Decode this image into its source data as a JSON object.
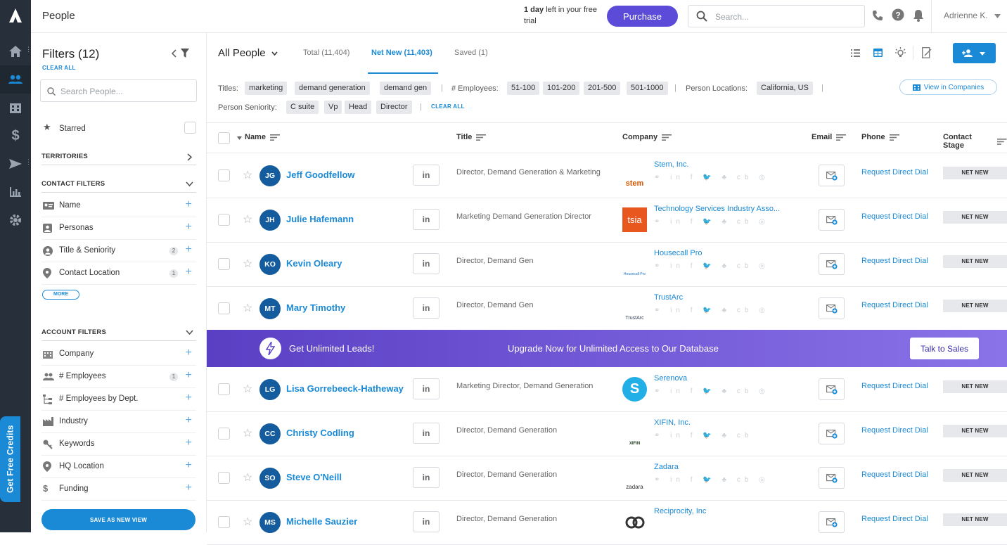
{
  "app": {
    "page_title": "People"
  },
  "topbar": {
    "trial_bold": "1 day",
    "trial_rest": " left in your free trial",
    "purchase_label": "Purchase",
    "search_placeholder": "Search...",
    "user_name": "Adrienne K."
  },
  "rail": {
    "get_free_credits": "Get Free Credits"
  },
  "sidebar": {
    "title": "Filters (12)",
    "clear_all": "CLEAR ALL",
    "search_placeholder": "Search People...",
    "starred": "Starred",
    "territories": "TERRITORIES",
    "contact_filters_header": "CONTACT FILTERS",
    "contact_filters": [
      {
        "label": "Name",
        "count": ""
      },
      {
        "label": "Personas",
        "count": ""
      },
      {
        "label": "Title & Seniority",
        "count": "2"
      },
      {
        "label": "Contact Location",
        "count": "1"
      }
    ],
    "more": "MORE",
    "account_filters_header": "ACCOUNT FILTERS",
    "account_filters": [
      {
        "label": "Company",
        "count": ""
      },
      {
        "label": "# Employees",
        "count": "1"
      },
      {
        "label": "# Employees by Dept.",
        "count": ""
      },
      {
        "label": "Industry",
        "count": ""
      },
      {
        "label": "Keywords",
        "count": ""
      },
      {
        "label": "HQ Location",
        "count": ""
      },
      {
        "label": "Funding",
        "count": ""
      }
    ],
    "save_view": "SAVE AS NEW VIEW"
  },
  "main": {
    "view_selector": "All People",
    "tabs": [
      {
        "label": "Total (11,404)"
      },
      {
        "label": "Net New (11,403)"
      },
      {
        "label": "Saved (1)"
      }
    ],
    "filters": {
      "titles_label": "Titles:",
      "titles": [
        "marketing",
        "demand generation",
        "demand gen"
      ],
      "employees_label": "# Employees:",
      "employees": [
        "51-100",
        "101-200",
        "201-500",
        "501-1000"
      ],
      "locations_label": "Person Locations:",
      "locations": [
        "California, US"
      ],
      "seniority_label": "Person Seniority:",
      "seniority": [
        "C suite",
        "Vp",
        "Head",
        "Director"
      ],
      "clear_all": "CLEAR ALL",
      "view_in_companies": "View in Companies"
    },
    "columns": {
      "name": "Name",
      "title": "Title",
      "company": "Company",
      "email": "Email",
      "phone": "Phone",
      "stage": "Contact Stage"
    },
    "rows": [
      {
        "initials": "JG",
        "name": "Jeff Goodfellow",
        "title": "Director, Demand Generation & Marketing",
        "company": "Stem, Inc.",
        "logo_text": "stem",
        "phone": "Request Direct Dial",
        "stage": "NET NEW",
        "socials": "⚭ in f 🐦 ♣ cb ◎"
      },
      {
        "initials": "JH",
        "name": "Julie Hafemann",
        "title": "Marketing Demand Generation Director",
        "company": "Technology Services Industry Asso...",
        "logo_text": "tsia",
        "phone": "Request Direct Dial",
        "stage": "NET NEW",
        "socials": "⚭ in f 🐦 ♣ cb ◎"
      },
      {
        "initials": "KO",
        "name": "Kevin Oleary",
        "title": "Director, Demand Gen",
        "company": "Housecall Pro",
        "logo_text": "Housecall Pro",
        "phone": "Request Direct Dial",
        "stage": "NET NEW",
        "socials": "⚭ in f 🐦 ♣ cb ◎"
      },
      {
        "initials": "MT",
        "name": "Mary Timothy",
        "title": "Director, Demand Gen",
        "company": "TrustArc",
        "logo_text": "TrustArc",
        "phone": "Request Direct Dial",
        "stage": "NET NEW",
        "socials": "⚭ in f 🐦 ♣ cb ◎"
      }
    ],
    "banner": {
      "left": "Get Unlimited Leads!",
      "middle": "Upgrade Now for Unlimited Access to Our Database",
      "cta": "Talk to Sales"
    },
    "rows2": [
      {
        "initials": "LG",
        "name": "Lisa Gorrebeeck-Hatheway",
        "title": "Marketing Director, Demand Generation",
        "company": "Serenova",
        "logo_text": "S",
        "phone": "Request Direct Dial",
        "stage": "NET NEW",
        "socials": "⚭ in f 🐦 ♣ cb ◎"
      },
      {
        "initials": "CC",
        "name": "Christy Codling",
        "title": "Director, Demand Generation",
        "company": "XIFIN, Inc.",
        "logo_text": "XIFIN",
        "phone": "Request Direct Dial",
        "stage": "NET NEW",
        "socials": "⚭ in f 🐦 ♣ cb"
      },
      {
        "initials": "SO",
        "name": "Steve O'Neill",
        "title": "Director, Demand Generation",
        "company": "Zadara",
        "logo_text": "zadara",
        "phone": "Request Direct Dial",
        "stage": "NET NEW",
        "socials": "⚭ in f 🐦 ♣ cb ◎"
      },
      {
        "initials": "MS",
        "name": "Michelle Sauzier",
        "title": "Director, Demand Generation",
        "company": "Reciprocity, Inc",
        "logo_text": "",
        "phone": "Request Direct Dial",
        "stage": "NET NEW",
        "socials": ""
      }
    ]
  },
  "colors": {
    "accent": "#1a8ad7",
    "purchase": "#5b4bd8",
    "rail": "#27303a",
    "avatar": "#155c9f"
  }
}
